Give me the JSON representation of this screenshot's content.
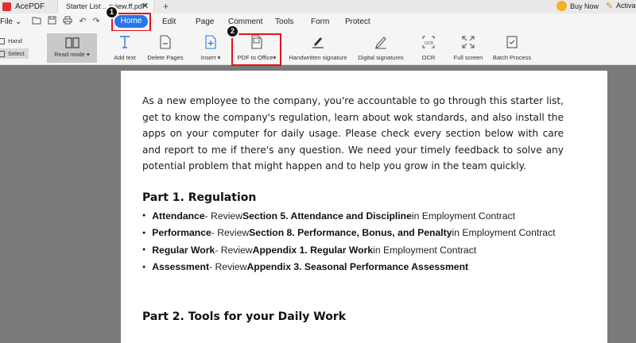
{
  "titlebar": {
    "app_name": "AcePDF",
    "tab_title": "Starter List ...eview.ff.pdf*",
    "close_glyph": "✕",
    "new_tab_glyph": "+",
    "buy_now": "Buy Now",
    "activate": "Activat"
  },
  "menubar": {
    "file": "File ⌄",
    "tabs": [
      "Home",
      "Edit",
      "Page",
      "Comment",
      "Tools",
      "Form",
      "Protect"
    ]
  },
  "ribbon": {
    "hand": "Hand",
    "select": "Select",
    "read_mode": "Read mode ▾",
    "add_text": "Add text",
    "delete_pages": "Delete Pages",
    "insert": "Insert ▾",
    "pdf_to_office": "PDF to Office▾",
    "handwritten_signature": "Handwritten signature",
    "digital_signatures": "Digital signatures",
    "ocr": "OCR",
    "full_screen": "Full screen",
    "batch_process": "Batch Process"
  },
  "annotations": {
    "badge_1": "1",
    "badge_2": "2"
  },
  "document": {
    "intro": "As a new employee to the company, you're accountable to go through this starter list, get to know the company's regulation, learn about wok standards, and also install the apps on your computer for daily usage. Please check every section below with care and report to me if there's any question. We need your timely feedback to solve any potential problem that might happen and to help you grow in the team quickly.",
    "part1_heading": "Part 1. Regulation",
    "bullets": [
      {
        "term": "Attendance",
        "mid": " - Review ",
        "ref": "Section 5. Attendance and Discipline",
        "tail": " in Employment Contract"
      },
      {
        "term": "Performance",
        "mid": " - Review ",
        "ref": "Section 8. Performance, Bonus, and Penalty",
        "tail": " in Employment Contract"
      },
      {
        "term": "Regular Work",
        "mid": " - Review ",
        "ref": "Appendix 1. Regular Work",
        "tail": " in Employment Contract"
      },
      {
        "term": "Assessment",
        "mid": " - Review ",
        "ref": "Appendix 3. Seasonal Performance Assessment",
        "tail": ""
      }
    ],
    "part2_heading": "Part 2. Tools for your Daily Work"
  },
  "colors": {
    "accent": "#2877e8",
    "highlight": "#e0131c",
    "logo": "#e0312e"
  }
}
